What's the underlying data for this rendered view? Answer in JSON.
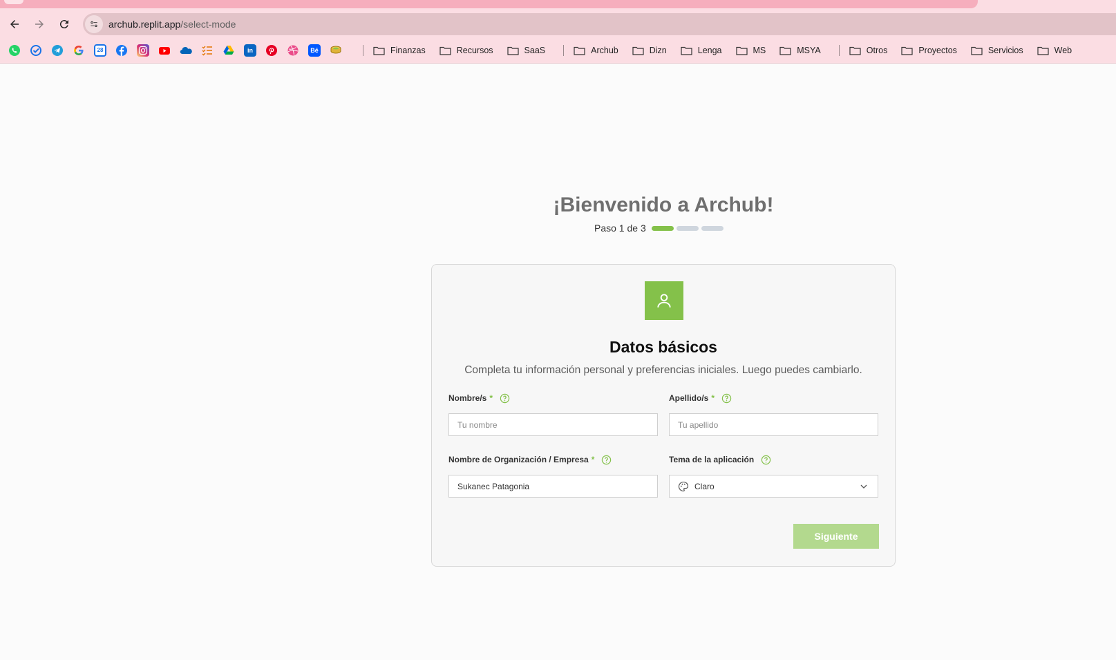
{
  "browser": {
    "url_host": "archub.replit.app",
    "url_path": "/select-mode",
    "bookmark_icons": [
      {
        "name": "whatsapp-icon",
        "color": "#25d366"
      },
      {
        "name": "checkmark-app-icon",
        "color": "#1a73e8"
      },
      {
        "name": "telegram-icon",
        "color": "#229ed9"
      },
      {
        "name": "google-icon",
        "color": "#ffffff"
      },
      {
        "name": "calendar-icon",
        "color": "#1a73e8"
      },
      {
        "name": "facebook-icon",
        "color": "#1877f2"
      },
      {
        "name": "instagram-icon",
        "color": "#d62976"
      },
      {
        "name": "youtube-icon",
        "color": "#ff0000"
      },
      {
        "name": "onedrive-icon",
        "color": "#0364b8"
      },
      {
        "name": "checklist-icon",
        "color": "#e37400"
      },
      {
        "name": "google-drive-icon",
        "color": "#34a853"
      },
      {
        "name": "linkedin-icon",
        "color": "#0a66c2"
      },
      {
        "name": "pinterest-icon",
        "color": "#e60023"
      },
      {
        "name": "dribbble-icon",
        "color": "#ea4c89"
      },
      {
        "name": "behance-icon",
        "color": "#0057ff"
      },
      {
        "name": "coins-icon",
        "color": "#c9a227"
      }
    ],
    "behance_text": "Bē",
    "calendar_text": "28",
    "folders_group1": [
      "Finanzas",
      "Recursos",
      "SaaS"
    ],
    "folders_group2": [
      "Archub",
      "Dizn",
      "Lenga",
      "MS",
      "MSYA"
    ],
    "folders_group3": [
      "Otros",
      "Proyectos",
      "Servicios",
      "Web"
    ]
  },
  "onboarding": {
    "title": "¡Bienvenido a Archub!",
    "step_label": "Paso 1 de 3",
    "current_step": 1,
    "total_steps": 3
  },
  "card": {
    "heading": "Datos básicos",
    "subtitle": "Completa tu información personal y preferencias iniciales. Luego puedes cambiarlo.",
    "fields": {
      "first_name": {
        "label": "Nombre/s",
        "required": "*",
        "placeholder": "Tu nombre",
        "value": ""
      },
      "last_name": {
        "label": "Apellido/s",
        "required": "*",
        "placeholder": "Tu apellido",
        "value": ""
      },
      "organization": {
        "label": "Nombre de Organización / Empresa",
        "required": "*",
        "value": "Sukanec Patagonia"
      },
      "theme": {
        "label": "Tema de la aplicación",
        "value": "Claro"
      }
    },
    "next_button": "Siguiente"
  },
  "colors": {
    "accent": "#84c14a",
    "accent_disabled": "#b3d98e",
    "step_inactive": "#cfd6de"
  }
}
